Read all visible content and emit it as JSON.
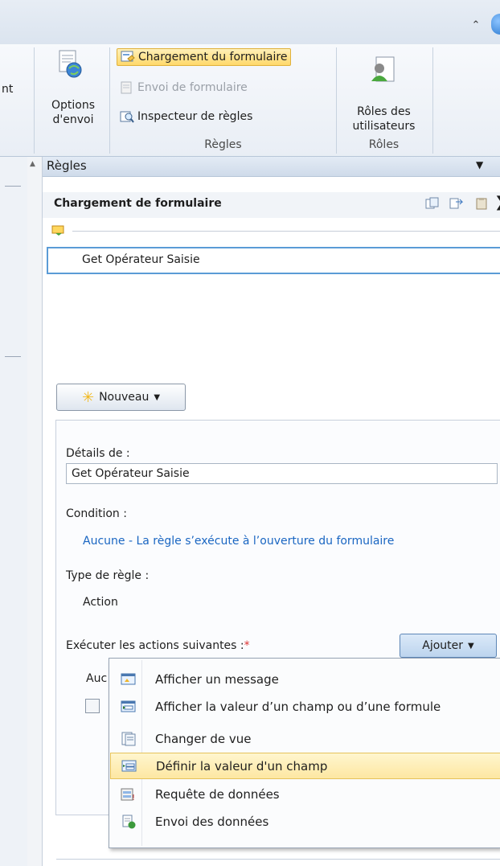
{
  "ribbon": {
    "cut_label": "nt",
    "options_envoi": [
      "Options",
      "d'envoi"
    ],
    "chargement": "Chargement du formulaire",
    "envoi": "Envoi de formulaire",
    "inspecteur": "Inspecteur de règles",
    "regles_group": "Règles",
    "roles_btn": [
      "Rôles des",
      "utilisateurs"
    ],
    "roles_group": "Rôles"
  },
  "panel": {
    "title": "Règles",
    "subtitle": "Chargement de formulaire",
    "rule_item": "Get Opérateur Saisie",
    "new_button": "Nouveau",
    "details_label": "Détails de :",
    "details_value": "Get Opérateur Saisie",
    "condition_label": "Condition :",
    "condition_value": "Aucune - La règle s’exécute à l’ouverture du formulaire",
    "rule_type_label": "Type de règle :",
    "rule_type_value": "Action",
    "actions_label": "Exécuter les actions suivantes :",
    "required_mark": "*",
    "add_button": "Ajouter",
    "actions_placeholder": "Auc"
  },
  "menu": {
    "items": [
      {
        "label": "Afficher un message",
        "icon": "message-icon"
      },
      {
        "label": "Afficher la valeur d’un champ ou d’une formule",
        "icon": "field-value-icon"
      },
      {
        "label": "Changer de vue",
        "icon": "view-icon"
      },
      {
        "label": "Définir la valeur d'un champ",
        "icon": "set-field-icon"
      },
      {
        "label": "Requête de données",
        "icon": "query-icon"
      },
      {
        "label": "Envoi des données",
        "icon": "submit-icon"
      }
    ],
    "highlighted_index": 3
  }
}
